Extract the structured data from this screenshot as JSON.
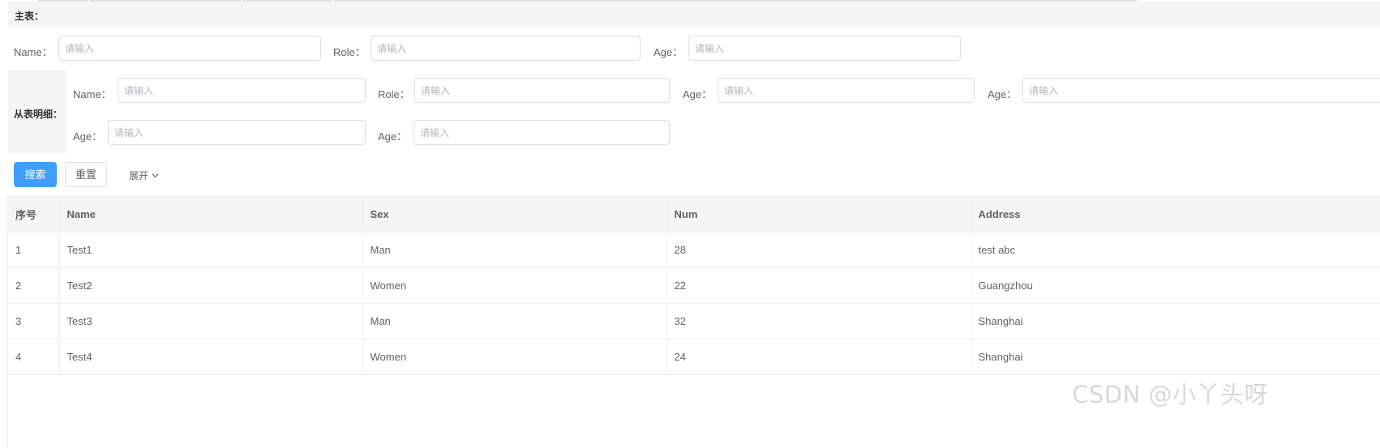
{
  "main_section": {
    "title": "主表：",
    "fields": [
      {
        "label": "Name：",
        "placeholder": "请输入"
      },
      {
        "label": "Role：",
        "placeholder": "请输入"
      },
      {
        "label": "Age：",
        "placeholder": "请输入"
      }
    ]
  },
  "detail_section": {
    "title": "从表明细：",
    "row1": [
      {
        "label": "Name：",
        "placeholder": "请输入"
      },
      {
        "label": "Role：",
        "placeholder": "请输入"
      },
      {
        "label": "Age：",
        "placeholder": "请输入"
      },
      {
        "label": "Age：",
        "placeholder": "请输入"
      }
    ],
    "row2": [
      {
        "label": "Age：",
        "placeholder": "请输入"
      },
      {
        "label": "Age：",
        "placeholder": "请输入"
      }
    ]
  },
  "actions": {
    "search_label": "搜索",
    "reset_label": "重置",
    "expand_label": "展开",
    "primary_color": "#409eff"
  },
  "table": {
    "columns": [
      "序号",
      "Name",
      "Sex",
      "Num",
      "Address"
    ],
    "rows": [
      [
        "1",
        "Test1",
        "Man",
        "28",
        "test abc"
      ],
      [
        "2",
        "Test2",
        "Women",
        "22",
        "Guangzhou"
      ],
      [
        "3",
        "Test3",
        "Man",
        "32",
        "Shanghai"
      ],
      [
        "4",
        "Test4",
        "Women",
        "24",
        "Shanghai"
      ]
    ]
  },
  "watermark": "CSDN @小丫头呀"
}
